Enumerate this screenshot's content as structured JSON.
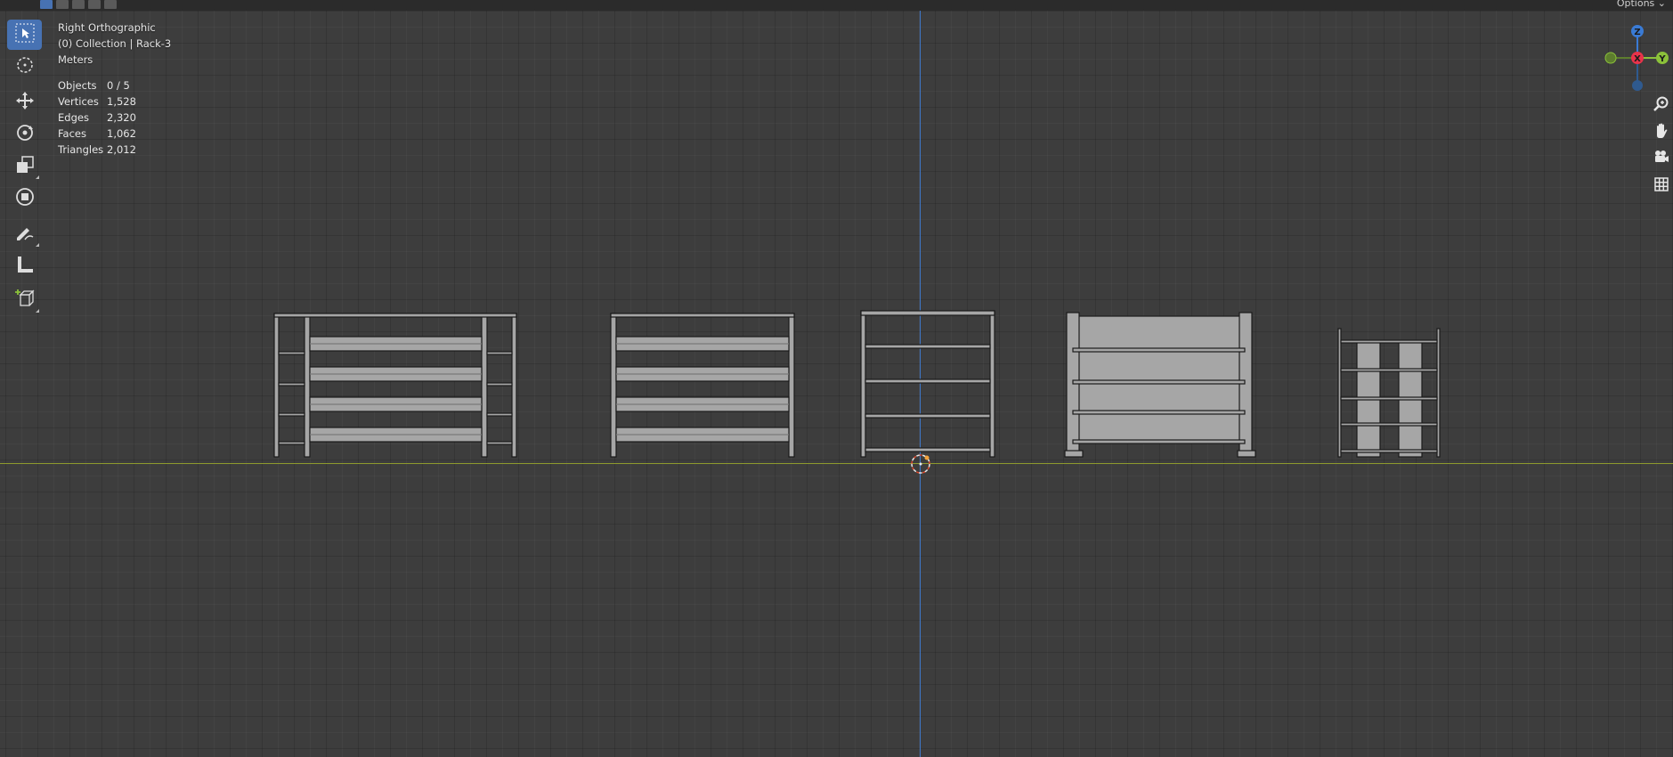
{
  "view": {
    "title": "Right Orthographic",
    "collection": "(0) Collection | Rack-3",
    "units": "Meters"
  },
  "stats": [
    {
      "label": "Objects",
      "value": "0 / 5"
    },
    {
      "label": "Vertices",
      "value": "1,528"
    },
    {
      "label": "Edges",
      "value": "2,320"
    },
    {
      "label": "Faces",
      "value": "1,062"
    },
    {
      "label": "Triangles",
      "value": "2,012"
    }
  ],
  "header": {
    "options_label": "Options"
  },
  "toolbar": {
    "tools": [
      {
        "name": "select-box-tool",
        "icon": "cursor-select-icon",
        "active": true
      },
      {
        "name": "cursor-tool",
        "icon": "3d-cursor-icon",
        "active": false
      },
      {
        "name": "move-tool",
        "icon": "move-arrows-icon",
        "active": false
      },
      {
        "name": "rotate-tool",
        "icon": "rotate-icon",
        "active": false
      },
      {
        "name": "scale-tool",
        "icon": "scale-icon",
        "active": false
      },
      {
        "name": "transform-tool",
        "icon": "transform-icon",
        "active": false
      },
      {
        "name": "annotate-tool",
        "icon": "pencil-icon",
        "active": false
      },
      {
        "name": "measure-tool",
        "icon": "ruler-icon",
        "active": false
      },
      {
        "name": "add-cube-tool",
        "icon": "add-cube-icon",
        "active": false
      }
    ]
  },
  "gizmo": {
    "axes": [
      "Z",
      "X",
      "Y"
    ],
    "colors": {
      "z": "#3a7bd5",
      "x": "#e8334a",
      "y": "#8bc13a"
    }
  },
  "colors": {
    "background": "#3d3d3d",
    "accent": "#4772b3",
    "axis_z": "#3f78c9",
    "axis_y": "#8e9a2d",
    "object_fill": "#a6a6a6",
    "object_outline": "#1a1a1a"
  }
}
